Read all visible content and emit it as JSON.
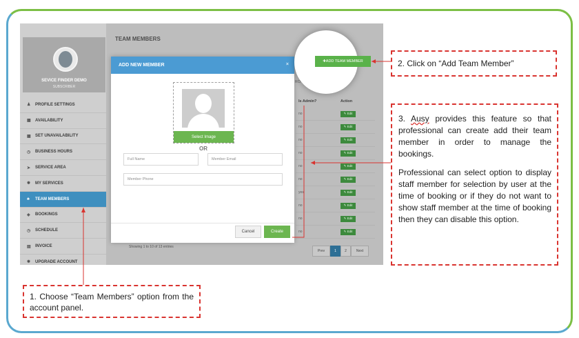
{
  "app": {
    "page_title": "TEAM MEMBERS",
    "search_label": "RCH:",
    "profile": {
      "name": "SEVICE FINDER DEMO",
      "role": "SUBSCRIBER"
    }
  },
  "sidebar": {
    "items": [
      {
        "label": "PROFILE SETTINGS",
        "icon": "user-icon",
        "glyph": "♟"
      },
      {
        "label": "AVAILABILITY",
        "icon": "calendar-icon",
        "glyph": "▦"
      },
      {
        "label": "SET UNAVAILABILITY",
        "icon": "calendar-icon",
        "glyph": "▦"
      },
      {
        "label": "BUSINESS HOURS",
        "icon": "clock-icon",
        "glyph": "◷"
      },
      {
        "label": "SERVICE AREA",
        "icon": "location-icon",
        "glyph": "➤"
      },
      {
        "label": "MY SERVICES",
        "icon": "gear-icon",
        "glyph": "✹"
      },
      {
        "label": "TEAM MEMBERS",
        "icon": "team-icon",
        "glyph": "♣"
      },
      {
        "label": "BOOKINGS",
        "icon": "bookings-icon",
        "glyph": "◈"
      },
      {
        "label": "SCHEDULE",
        "icon": "schedule-icon",
        "glyph": "◷"
      },
      {
        "label": "INVOICE",
        "icon": "invoice-icon",
        "glyph": "▤"
      },
      {
        "label": "UPGRADE ACCOUNT",
        "icon": "upgrade-icon",
        "glyph": "✹"
      }
    ]
  },
  "table": {
    "headers": {
      "is_admin": "Is Admin?",
      "action": "Action"
    },
    "rows": [
      "no",
      "no",
      "no",
      "no",
      "no",
      "no",
      "yes",
      "no",
      "no",
      "no"
    ],
    "edit_label": "✎ Edit",
    "showing": "Showing 1 to 10 of 13 entries"
  },
  "pagination": {
    "prev": "Prev",
    "pages": [
      "1",
      "2"
    ],
    "next": "Next"
  },
  "modal": {
    "title": "ADD NEW MEMBER",
    "close": "×",
    "select_image": "Select Image",
    "or": "OR",
    "full_name_placeholder": "Full Name",
    "email_placeholder": "Member Email",
    "phone_placeholder": "Member Phone",
    "cancel": "Cancel",
    "create": "Create"
  },
  "add_member_button": "✚ADD TEAM MEMBER",
  "callouts": {
    "step1": "1. Choose “Team Members” option from the account panel.",
    "step2": "2. Click on “Add Team Member”",
    "step3_brand": "Ausy",
    "step3_prefix": "3. ",
    "step3_rest": " provides this feature so that professional can create add their team member in order to manage the bookings.",
    "step3_p2": "Professional can select option to display staff member for selection by user at the time of booking or if they do not want to show staff member at the time of booking then they can disable this option."
  },
  "colors": {
    "accent_blue": "#4b9bd3",
    "accent_green": "#6cb650",
    "callout_red": "#d9332f"
  }
}
